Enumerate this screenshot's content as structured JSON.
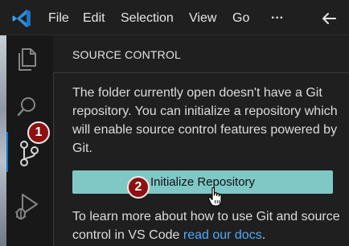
{
  "menu": {
    "file": "File",
    "edit": "Edit",
    "selection": "Selection",
    "view": "View",
    "go": "Go",
    "more": "···"
  },
  "sidebar": {
    "title": "SOURCE CONTROL",
    "message": "The folder currently open doesn't have a Git repository. You can initialize a repository which will enable source control features powered by Git.",
    "init_button_label": "Initialize Repository",
    "learn_more_text": "To learn more about how to use Git and source control in VS Code",
    "docs_link": "read our docs",
    "learn_more_suffix": "."
  },
  "badges": {
    "step1": "1",
    "step2": "2"
  },
  "colors": {
    "accent": "#0078d4",
    "button_bg": "#7fc8c6",
    "badge_bg": "#8e1010",
    "link": "#4daafc"
  },
  "icons": {
    "logo": "vscode-logo-icon",
    "back": "arrow-left-icon",
    "explorer": "files-icon",
    "search": "search-icon",
    "source_control": "source-control-icon",
    "run_debug": "run-debug-icon",
    "cursor": "hand-pointer-icon"
  }
}
